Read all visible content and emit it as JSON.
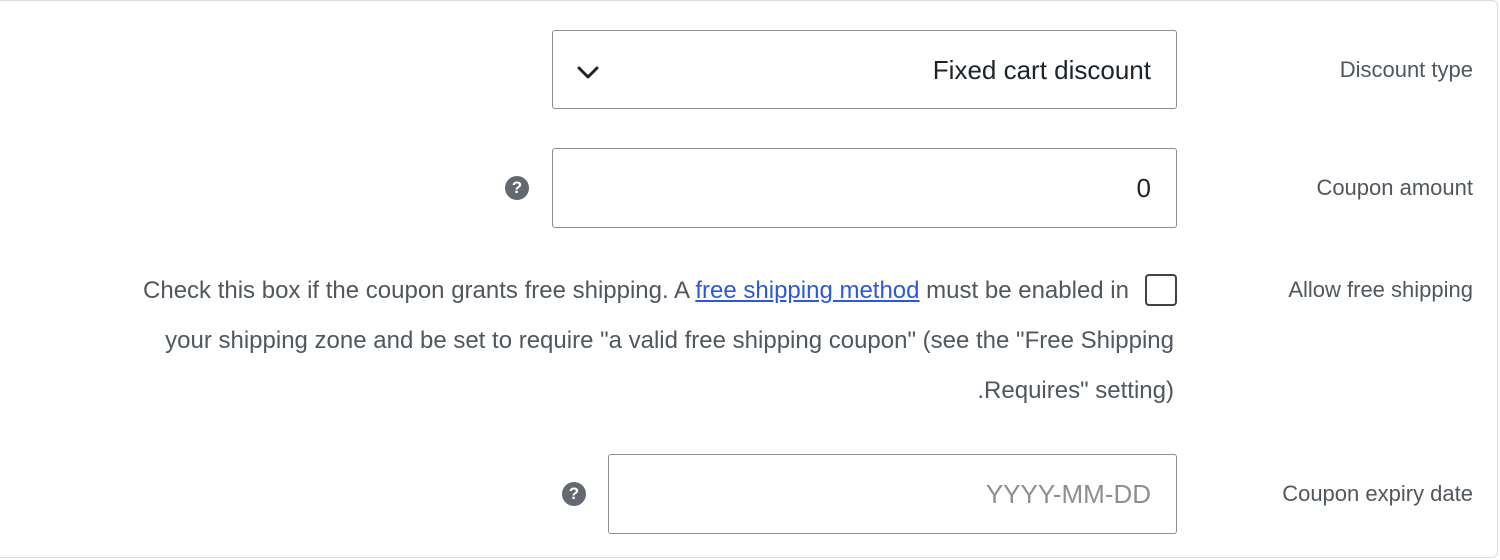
{
  "discount_type": {
    "label": "Discount type",
    "selected_value": "Fixed cart discount",
    "chevron_icon": "chevron-down-icon"
  },
  "coupon_amount": {
    "label": "Coupon amount",
    "value": "0",
    "help_icon": "question-icon",
    "help_glyph": "?"
  },
  "free_shipping": {
    "label": "Allow free shipping",
    "checked": false,
    "description_line1_before": "Check this box if the coupon grants free shipping. A ",
    "description_link": "free shipping method",
    "description_line1_after": " must be enabled in",
    "description_line2": "your shipping zone and be set to require \"a valid free shipping coupon\" (see the \"Free Shipping",
    "description_line3": ".Requires\" setting)"
  },
  "expiry_date": {
    "label": "Coupon expiry date",
    "value": "",
    "placeholder": "YYYY-MM-DD",
    "help_icon": "question-icon",
    "help_glyph": "?"
  }
}
